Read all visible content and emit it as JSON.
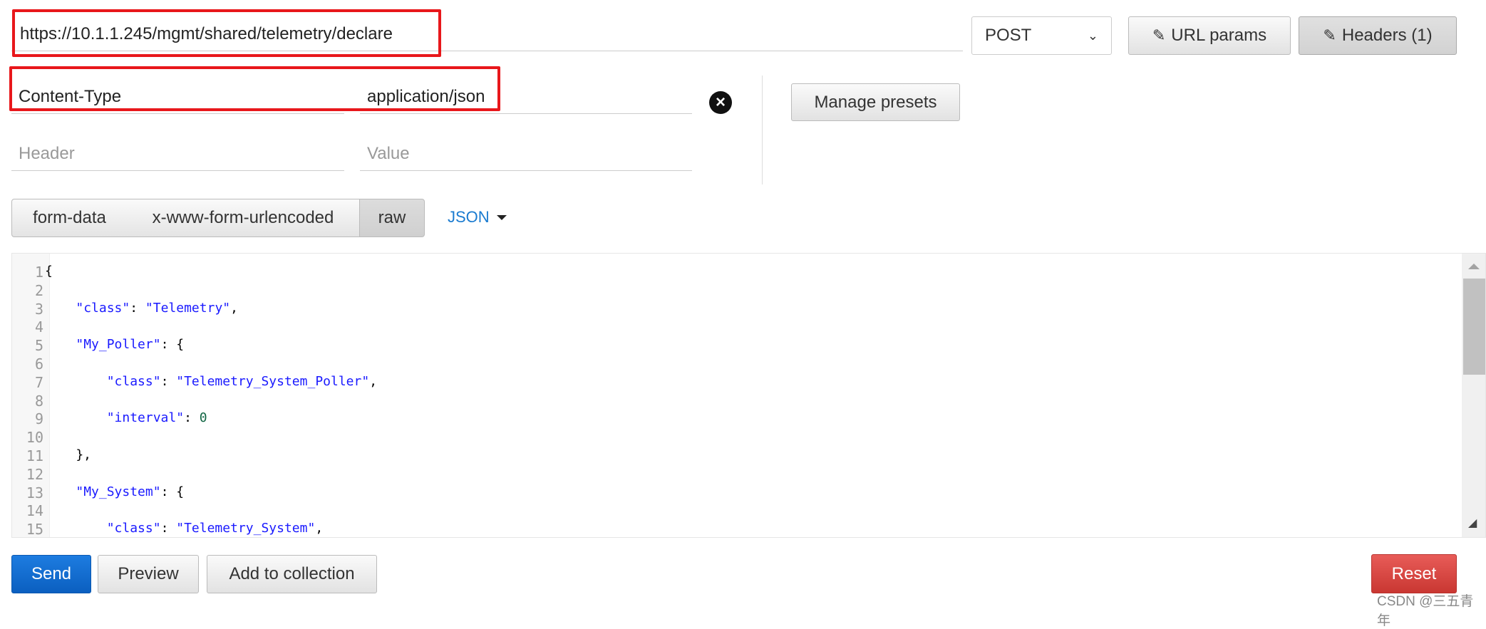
{
  "request": {
    "url": "https://10.1.1.245/mgmt/shared/telemetry/declare",
    "method": "POST",
    "url_params_label": "URL params",
    "headers_label": "Headers (1)"
  },
  "headers": {
    "rows": [
      {
        "name": "Content-Type",
        "value": "application/json"
      }
    ],
    "name_placeholder": "Header",
    "value_placeholder": "Value",
    "manage_presets_label": "Manage presets"
  },
  "body_tabs": {
    "items": [
      "form-data",
      "x-www-form-urlencoded",
      "raw"
    ],
    "active": "raw",
    "format": "JSON"
  },
  "editor": {
    "line_numbers": [
      "1",
      "2",
      "3",
      "4",
      "5",
      "6",
      "7",
      "8",
      "9",
      "10",
      "11",
      "12",
      "13",
      "14",
      "15"
    ],
    "lines": [
      "{",
      "",
      "    \"class\": \"Telemetry\",",
      "",
      "    \"My_Poller\": {",
      "",
      "        \"class\": \"Telemetry_System_Poller\",",
      "",
      "        \"interval\": 0",
      "",
      "    },",
      "",
      "    \"My_System\": {",
      "",
      "        \"class\": \"Telemetry_System\","
    ]
  },
  "footer": {
    "send_label": "Send",
    "preview_label": "Preview",
    "add_collection_label": "Add to collection",
    "reset_label": "Reset"
  },
  "watermark": "CSDN @三五青年",
  "colors": {
    "send": "#1a6fd1",
    "reset": "#d9433f",
    "highlight": "#e8171b",
    "link": "#1a7bd0"
  }
}
